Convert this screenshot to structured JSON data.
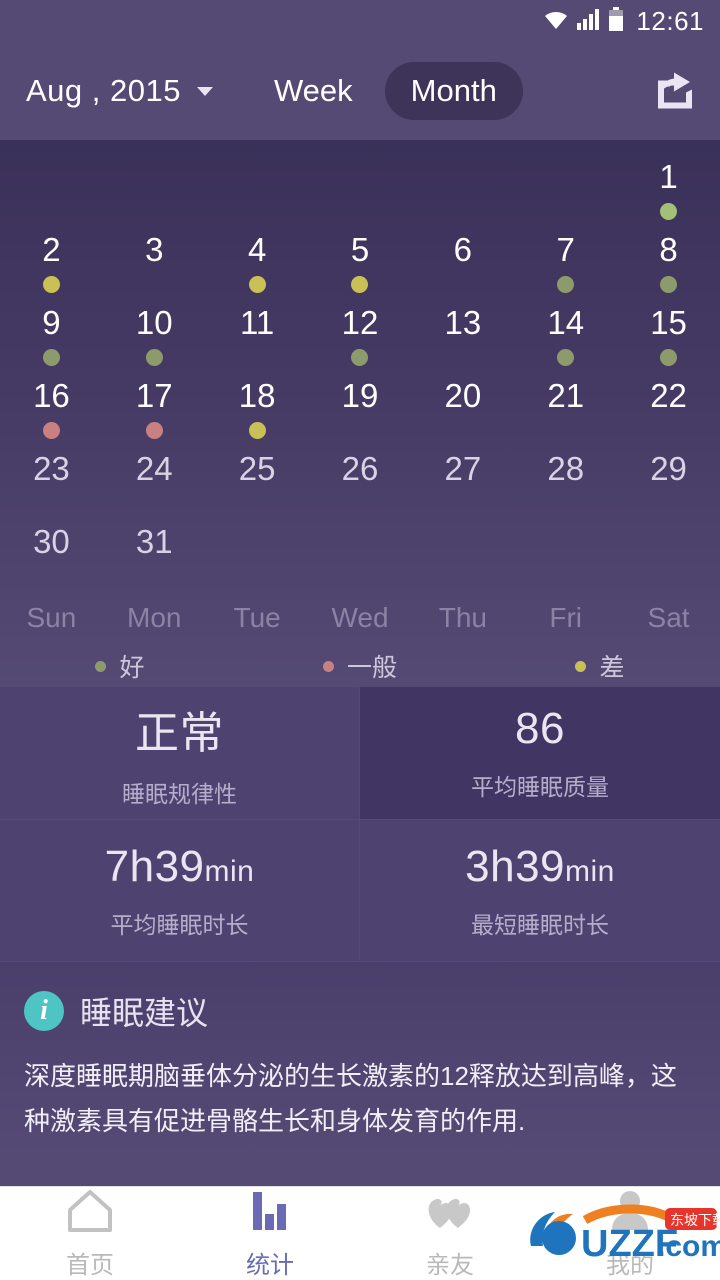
{
  "status_bar": {
    "time": "12:61",
    "wifi_icon": "wifi-icon",
    "signal_icon": "signal-icon",
    "battery_icon": "battery-icon"
  },
  "app_bar": {
    "month_label": "Aug , 2015",
    "dropdown_icon": "chevron-down-icon",
    "week_label": "Week",
    "month_tab_label": "Month",
    "share_icon": "share-icon"
  },
  "calendar": {
    "weekdays": [
      "Sun",
      "Mon",
      "Tue",
      "Wed",
      "Thu",
      "Fri",
      "Sat"
    ],
    "leading_blanks": 6,
    "days": [
      {
        "n": "1",
        "dot": "#a3bf78"
      },
      {
        "n": "2",
        "dot": "#c9c056"
      },
      {
        "n": "3",
        "dot": null
      },
      {
        "n": "4",
        "dot": "#c9c056"
      },
      {
        "n": "5",
        "dot": "#c9c056"
      },
      {
        "n": "6",
        "dot": null
      },
      {
        "n": "7",
        "dot": "#8d9b6c"
      },
      {
        "n": "8",
        "dot": "#8d9b6c"
      },
      {
        "n": "9",
        "dot": "#8d9b6c"
      },
      {
        "n": "10",
        "dot": "#8d9b6c"
      },
      {
        "n": "11",
        "dot": null
      },
      {
        "n": "12",
        "dot": "#8d9b6c"
      },
      {
        "n": "13",
        "dot": null
      },
      {
        "n": "14",
        "dot": "#8d9b6c"
      },
      {
        "n": "15",
        "dot": "#8d9b6c"
      },
      {
        "n": "16",
        "dot": "#c98080"
      },
      {
        "n": "17",
        "dot": "#c98080"
      },
      {
        "n": "18",
        "dot": "#c9c056"
      },
      {
        "n": "19",
        "dot": null
      },
      {
        "n": "20",
        "dot": null
      },
      {
        "n": "21",
        "dot": null
      },
      {
        "n": "22",
        "dot": null
      },
      {
        "n": "23",
        "dot": null
      },
      {
        "n": "24",
        "dot": null
      },
      {
        "n": "25",
        "dot": null
      },
      {
        "n": "26",
        "dot": null
      },
      {
        "n": "27",
        "dot": null
      },
      {
        "n": "28",
        "dot": null
      },
      {
        "n": "29",
        "dot": null
      },
      {
        "n": "30",
        "dot": null
      },
      {
        "n": "31",
        "dot": null
      }
    ],
    "legend": [
      {
        "label": "好",
        "color": "#8d9b6c"
      },
      {
        "label": "一般",
        "color": "#c98080"
      },
      {
        "label": "差",
        "color": "#c9c056"
      }
    ]
  },
  "stats": [
    {
      "value": "正常",
      "unit": "",
      "caption": "睡眠规律性"
    },
    {
      "value": "86",
      "unit": "",
      "caption": "平均睡眠质量"
    },
    {
      "value": "7h39",
      "unit": "min",
      "caption": "平均睡眠时长"
    },
    {
      "value": "3h39",
      "unit": "min",
      "caption": "最短睡眠时长"
    }
  ],
  "advice": {
    "icon": "info-icon",
    "title": "睡眠建议",
    "body": "深度睡眠期脑垂体分泌的生长激素的12释放达到高峰，这种激素具有促进骨骼生长和身体发育的作用."
  },
  "bottom_nav": [
    {
      "label": "首页",
      "icon": "home-icon",
      "active": false
    },
    {
      "label": "统计",
      "icon": "chart-icon",
      "active": true
    },
    {
      "label": "亲友",
      "icon": "hearts-icon",
      "active": false
    },
    {
      "label": "我的",
      "icon": "person-icon",
      "active": false
    }
  ],
  "watermark": {
    "text": "UZZF.com",
    "sub": "东坡下载"
  },
  "colors": {
    "background": "#554a74",
    "calendar_top": "#3a3159",
    "pill": "#3e3358",
    "accent": "#6b6bb5",
    "info": "#4ec4c4",
    "good": "#8d9b6c",
    "average": "#c98080",
    "poor": "#c9c056"
  }
}
